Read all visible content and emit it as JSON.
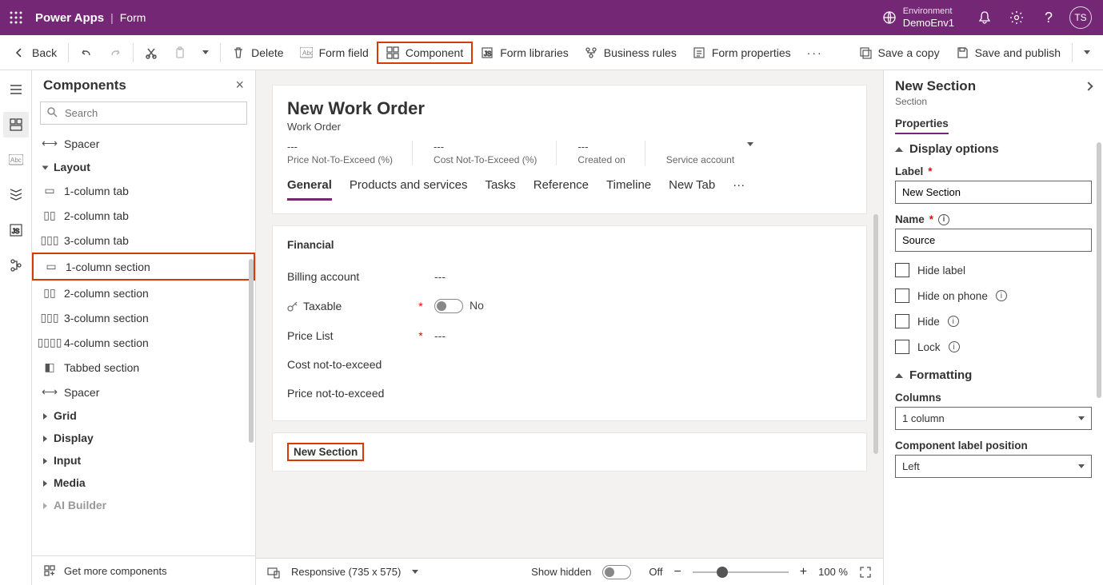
{
  "topbar": {
    "app": "Power Apps",
    "page": "Form",
    "env_label": "Environment",
    "env_name": "DemoEnv1",
    "avatar": "TS"
  },
  "toolbar": {
    "back": "Back",
    "delete": "Delete",
    "form_field": "Form field",
    "component": "Component",
    "form_libraries": "Form libraries",
    "business_rules": "Business rules",
    "form_properties": "Form properties",
    "save_copy": "Save a copy",
    "save_publish": "Save and publish"
  },
  "rail_icons": [
    "menu",
    "layout",
    "abc",
    "stacks",
    "js",
    "tree"
  ],
  "left_panel": {
    "title": "Components",
    "search_ph": "Search",
    "first_item": "Spacer",
    "layout_header": "Layout",
    "items": [
      {
        "label": "1-column tab",
        "hl": false
      },
      {
        "label": "2-column tab",
        "hl": false
      },
      {
        "label": "3-column tab",
        "hl": false
      },
      {
        "label": "1-column section",
        "hl": true
      },
      {
        "label": "2-column section",
        "hl": false
      },
      {
        "label": "3-column section",
        "hl": false
      },
      {
        "label": "4-column section",
        "hl": false
      },
      {
        "label": "Tabbed section",
        "hl": false
      },
      {
        "label": "Spacer",
        "hl": false
      }
    ],
    "groups": [
      "Grid",
      "Display",
      "Input",
      "Media",
      "AI Builder"
    ],
    "footer": "Get more components"
  },
  "form": {
    "title": "New Work Order",
    "entity": "Work Order",
    "meta": [
      {
        "val": "---",
        "lbl": "Price Not-To-Exceed (%)"
      },
      {
        "val": "---",
        "lbl": "Cost Not-To-Exceed (%)"
      },
      {
        "val": "---",
        "lbl": "Created on"
      },
      {
        "val": "",
        "lbl": "Service account"
      }
    ],
    "tabs": [
      "General",
      "Products and services",
      "Tasks",
      "Reference",
      "Timeline",
      "New Tab"
    ],
    "active_tab": "General",
    "section_title": "Financial",
    "fields": [
      {
        "label": "Billing account",
        "req": false,
        "value": "---",
        "icon": ""
      },
      {
        "label": "Taxable",
        "req": true,
        "value": "No",
        "icon": "key",
        "toggle": true
      },
      {
        "label": "Price List",
        "req": true,
        "value": "---",
        "icon": ""
      },
      {
        "label": "Cost not-to-exceed",
        "req": false,
        "value": "",
        "icon": ""
      },
      {
        "label": "Price not-to-exceed",
        "req": false,
        "value": "",
        "icon": ""
      }
    ],
    "new_section": "New Section"
  },
  "bottombar": {
    "responsive": "Responsive (735 x 575)",
    "show_hidden": "Show hidden",
    "off": "Off",
    "zoom": "100 %"
  },
  "right_panel": {
    "title": "New Section",
    "subtitle": "Section",
    "tab": "Properties",
    "display_header": "Display options",
    "label_label": "Label",
    "label_value": "New Section",
    "name_label": "Name",
    "name_value": "Source",
    "chk_hide_label": "Hide label",
    "chk_hide_phone": "Hide on phone",
    "chk_hide": "Hide",
    "chk_lock": "Lock",
    "formatting_header": "Formatting",
    "columns_label": "Columns",
    "columns_value": "1 column",
    "clp_label": "Component label position",
    "clp_value": "Left"
  }
}
